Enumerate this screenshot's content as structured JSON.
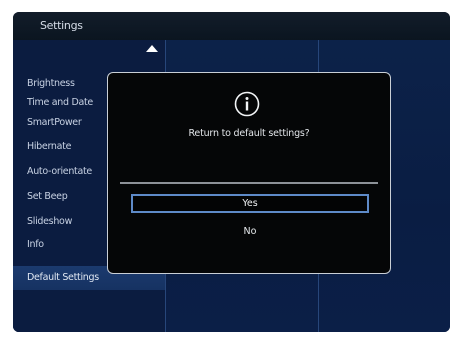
{
  "header": {
    "title": "Settings"
  },
  "menu": {
    "items": [
      {
        "label": "Brightness"
      },
      {
        "label": "Time and Date"
      },
      {
        "label": "SmartPower"
      },
      {
        "label": "Hibernate"
      },
      {
        "label": "Auto-orientate"
      },
      {
        "label": "Set Beep"
      },
      {
        "label": "Slideshow"
      },
      {
        "label": "Info"
      },
      {
        "label": "Default Settings"
      }
    ],
    "selected_index": 8,
    "scroll_icon": "chevron-up-icon"
  },
  "dialog": {
    "icon": "info-icon",
    "message": "Return to default settings?",
    "buttons": {
      "yes": "Yes",
      "no": "No"
    },
    "focused_button": "Yes"
  },
  "colors": {
    "background": "#0a1d43",
    "selection": "#1b3a6e",
    "dialog_bg": "#050607",
    "focus_border": "#5e8ac8"
  }
}
